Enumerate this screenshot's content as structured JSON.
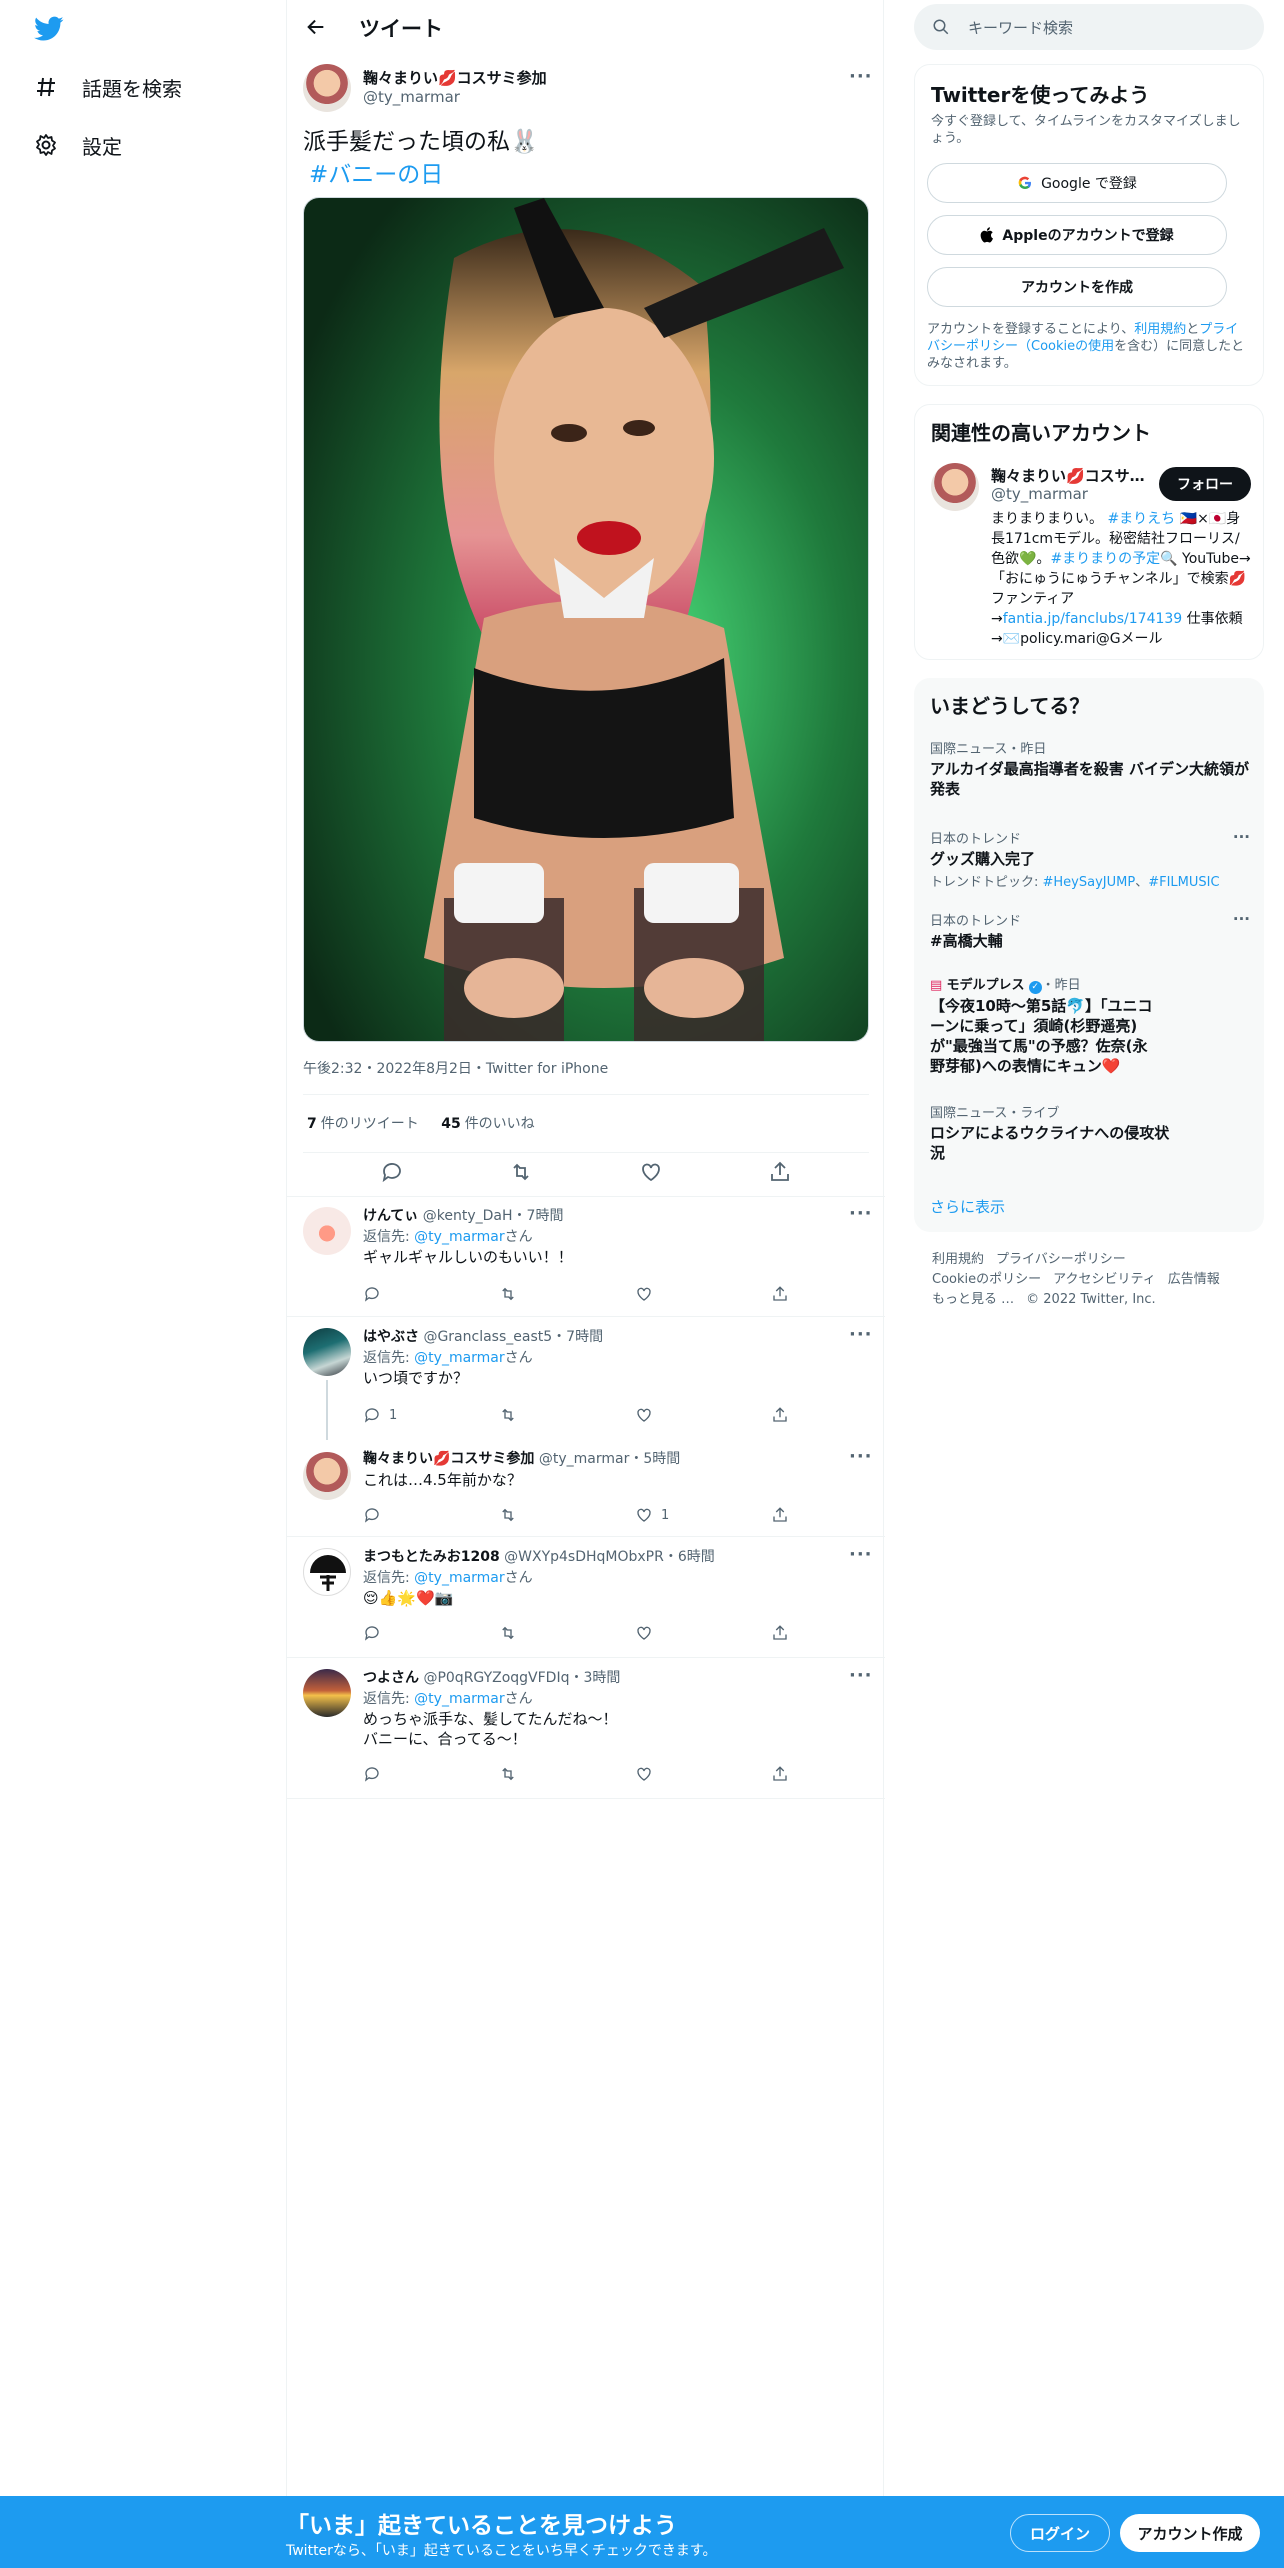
{
  "nav": {
    "logo": "twitter-bird-icon",
    "items": [
      {
        "label": "話題を検索",
        "icon": "hashtag-icon"
      },
      {
        "label": "設定",
        "icon": "gear-icon"
      }
    ]
  },
  "header": {
    "title": "ツイート"
  },
  "tweet": {
    "author_name": "鞠々まりい💋コスサミ参加",
    "author_handle": "@ty_marmar",
    "text": "派手髪だった頃の私🐰",
    "hashtag": "#バニーの日",
    "meta": "午後2:32・2022年8月2日・Twitter for iPhone",
    "retweets": "7",
    "retweets_label": "件のリツイート",
    "likes": "45",
    "likes_label": "件のいいね"
  },
  "replies": [
    {
      "name": "けんてぃ",
      "handle": "@kenty_DaH",
      "time": "・7時間",
      "to_prefix": "返信先: ",
      "to_handle": "@ty_marmar",
      "to_suffix": "さん",
      "text": "ギャルギャルしいのもいい！！",
      "reply_count": "",
      "like_count": ""
    },
    {
      "name": "はやぶさ",
      "handle": "@Granclass_east5",
      "time": "・7時間",
      "to_prefix": "返信先: ",
      "to_handle": "@ty_marmar",
      "to_suffix": "さん",
      "text": "いつ頃ですか？",
      "reply_count": "1",
      "like_count": ""
    },
    {
      "name": "鞠々まりい💋コスサミ参加",
      "handle": "@ty_marmar",
      "time": "・5時間",
      "text": "これは…4.5年前かな？",
      "reply_count": "",
      "like_count": "1"
    },
    {
      "name": "まつもとたみお1208",
      "handle": "@WXYp4sDHqMObxPR",
      "time": "・6時間",
      "to_prefix": "返信先: ",
      "to_handle": "@ty_marmar",
      "to_suffix": "さん",
      "text": "😌👍🌟❤️📷",
      "reply_count": "",
      "like_count": ""
    },
    {
      "name": "つよさん",
      "handle": "@P0qRGYZoqgVFDIq",
      "time": "・3時間",
      "to_prefix": "返信先: ",
      "to_handle": "@ty_marmar",
      "to_suffix": "さん",
      "text": "めっちゃ派手な、髪してたんだね～！",
      "text2": "バニーに、合ってる～！",
      "reply_count": "",
      "like_count": ""
    }
  ],
  "sidebar": {
    "search_placeholder": "キーワード検索",
    "signup_card": {
      "title": "Twitterを使ってみよう",
      "subtitle": "今すぐ登録して、タイムラインをカスタマイズしましょう。",
      "google": "Google で登録",
      "apple": "Appleのアカウントで登録",
      "create": "アカウントを作成",
      "legal_1": "アカウントを登録することにより、",
      "legal_terms": "利用規約",
      "legal_2": "と",
      "legal_privacy": "プライバシーポリシー（Cookieの使用",
      "legal_3": "を含む）に同意したとみなされます。"
    },
    "related": {
      "title": "関連性の高いアカウント",
      "name": "鞠々まりい💋コスサ…",
      "handle": "@ty_marmar",
      "follow": "フォロー",
      "bio_1": "まりまりまりい。",
      "bio_tag1": "#まりえち",
      "bio_2": " 🇵🇭×🇯🇵身長171cmモデル。秘密結社フローリス/色欲💚。",
      "bio_tag2": "#まりまりの予定",
      "bio_3": "🔍 YouTube→「おにゅうにゅうチャンネル」で検索💋 ファンティア→",
      "bio_link": "fantia.jp/fanclubs/174139",
      "bio_4": " 仕事依頼→✉️policy.mari@Gメール"
    },
    "trends": {
      "title": "いまどうしてる？",
      "items": [
        {
          "category": "国際ニュース・昨日",
          "title": "アルカイダ最高指導者を殺害 バイデン大統領が発表",
          "sub": ""
        },
        {
          "category": "日本のトレンド",
          "title": "グッズ購入完了",
          "sub_prefix": "トレンドトピック: ",
          "sub_tag1": "#HeySayJUMP",
          "sub_sep": "、",
          "sub_tag2": "#FILMUSIC"
        },
        {
          "category": "日本のトレンド",
          "title": "#高橋大輔",
          "sub": ""
        },
        {
          "category": "モデルプレス",
          "category_suffix": "・昨日",
          "title": "【今夜10時～第5話🐬】「ユニコーンに乗って」須崎(杉野遥亮)が\"最強当て馬\"の予感？佐奈(永野芽郁)への表情にキュン❤️",
          "sub": ""
        },
        {
          "category": "国際ニュース・ライブ",
          "title": "ロシアによるウクライナへの侵攻状況",
          "sub": ""
        }
      ],
      "show_more": "さらに表示"
    },
    "footer": {
      "links": [
        "利用規約",
        "プライバシーポリシー",
        "Cookieのポリシー",
        "アクセシビリティ",
        "広告情報",
        "もっと見る …"
      ],
      "copyright": "© 2022 Twitter, Inc."
    }
  },
  "bottom_bar": {
    "title": "「いま」起きていることを見つけよう",
    "subtitle": "Twitterなら、「いま」起きていることをいち早くチェックできます。",
    "login": "ログイン",
    "signup": "アカウント作成"
  },
  "colors": {
    "accent": "#1d9bf0",
    "text": "#0f1419",
    "muted": "#536471"
  }
}
